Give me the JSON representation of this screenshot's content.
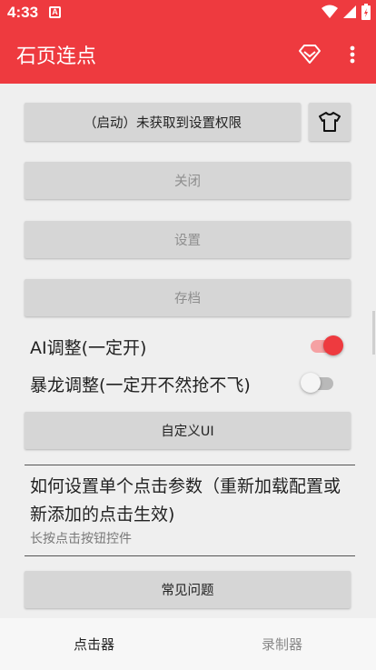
{
  "status_bar": {
    "time": "4:33",
    "notification_icon": "A"
  },
  "app_bar": {
    "title": "石页连点",
    "actions": [
      "diamond-icon",
      "more-vert-icon"
    ]
  },
  "buttons": {
    "start": "（启动）未获取到设置权限",
    "close": "关闭",
    "settings": "设置",
    "archive": "存档",
    "custom_ui": "自定义UI",
    "faq": "常见问题"
  },
  "toggles": {
    "ai_adjust": {
      "label": "AI调整(一定开)",
      "on": true
    },
    "tyrannosaurus_adjust": {
      "label": "暴龙调整(一定开不然抢不飞)",
      "on": false
    }
  },
  "info": {
    "title": "如何设置单个点击参数（重新加载配置或新添加的点击生效)",
    "subtitle": "长按点击按钮控件"
  },
  "bottom_nav": {
    "tabs": [
      {
        "label": "点击器",
        "active": true
      },
      {
        "label": "录制器",
        "active": false
      }
    ]
  },
  "colors": {
    "accent": "#ee3a3f",
    "accent_light": "#f5a1a3",
    "button_bg": "#d6d6d6"
  }
}
